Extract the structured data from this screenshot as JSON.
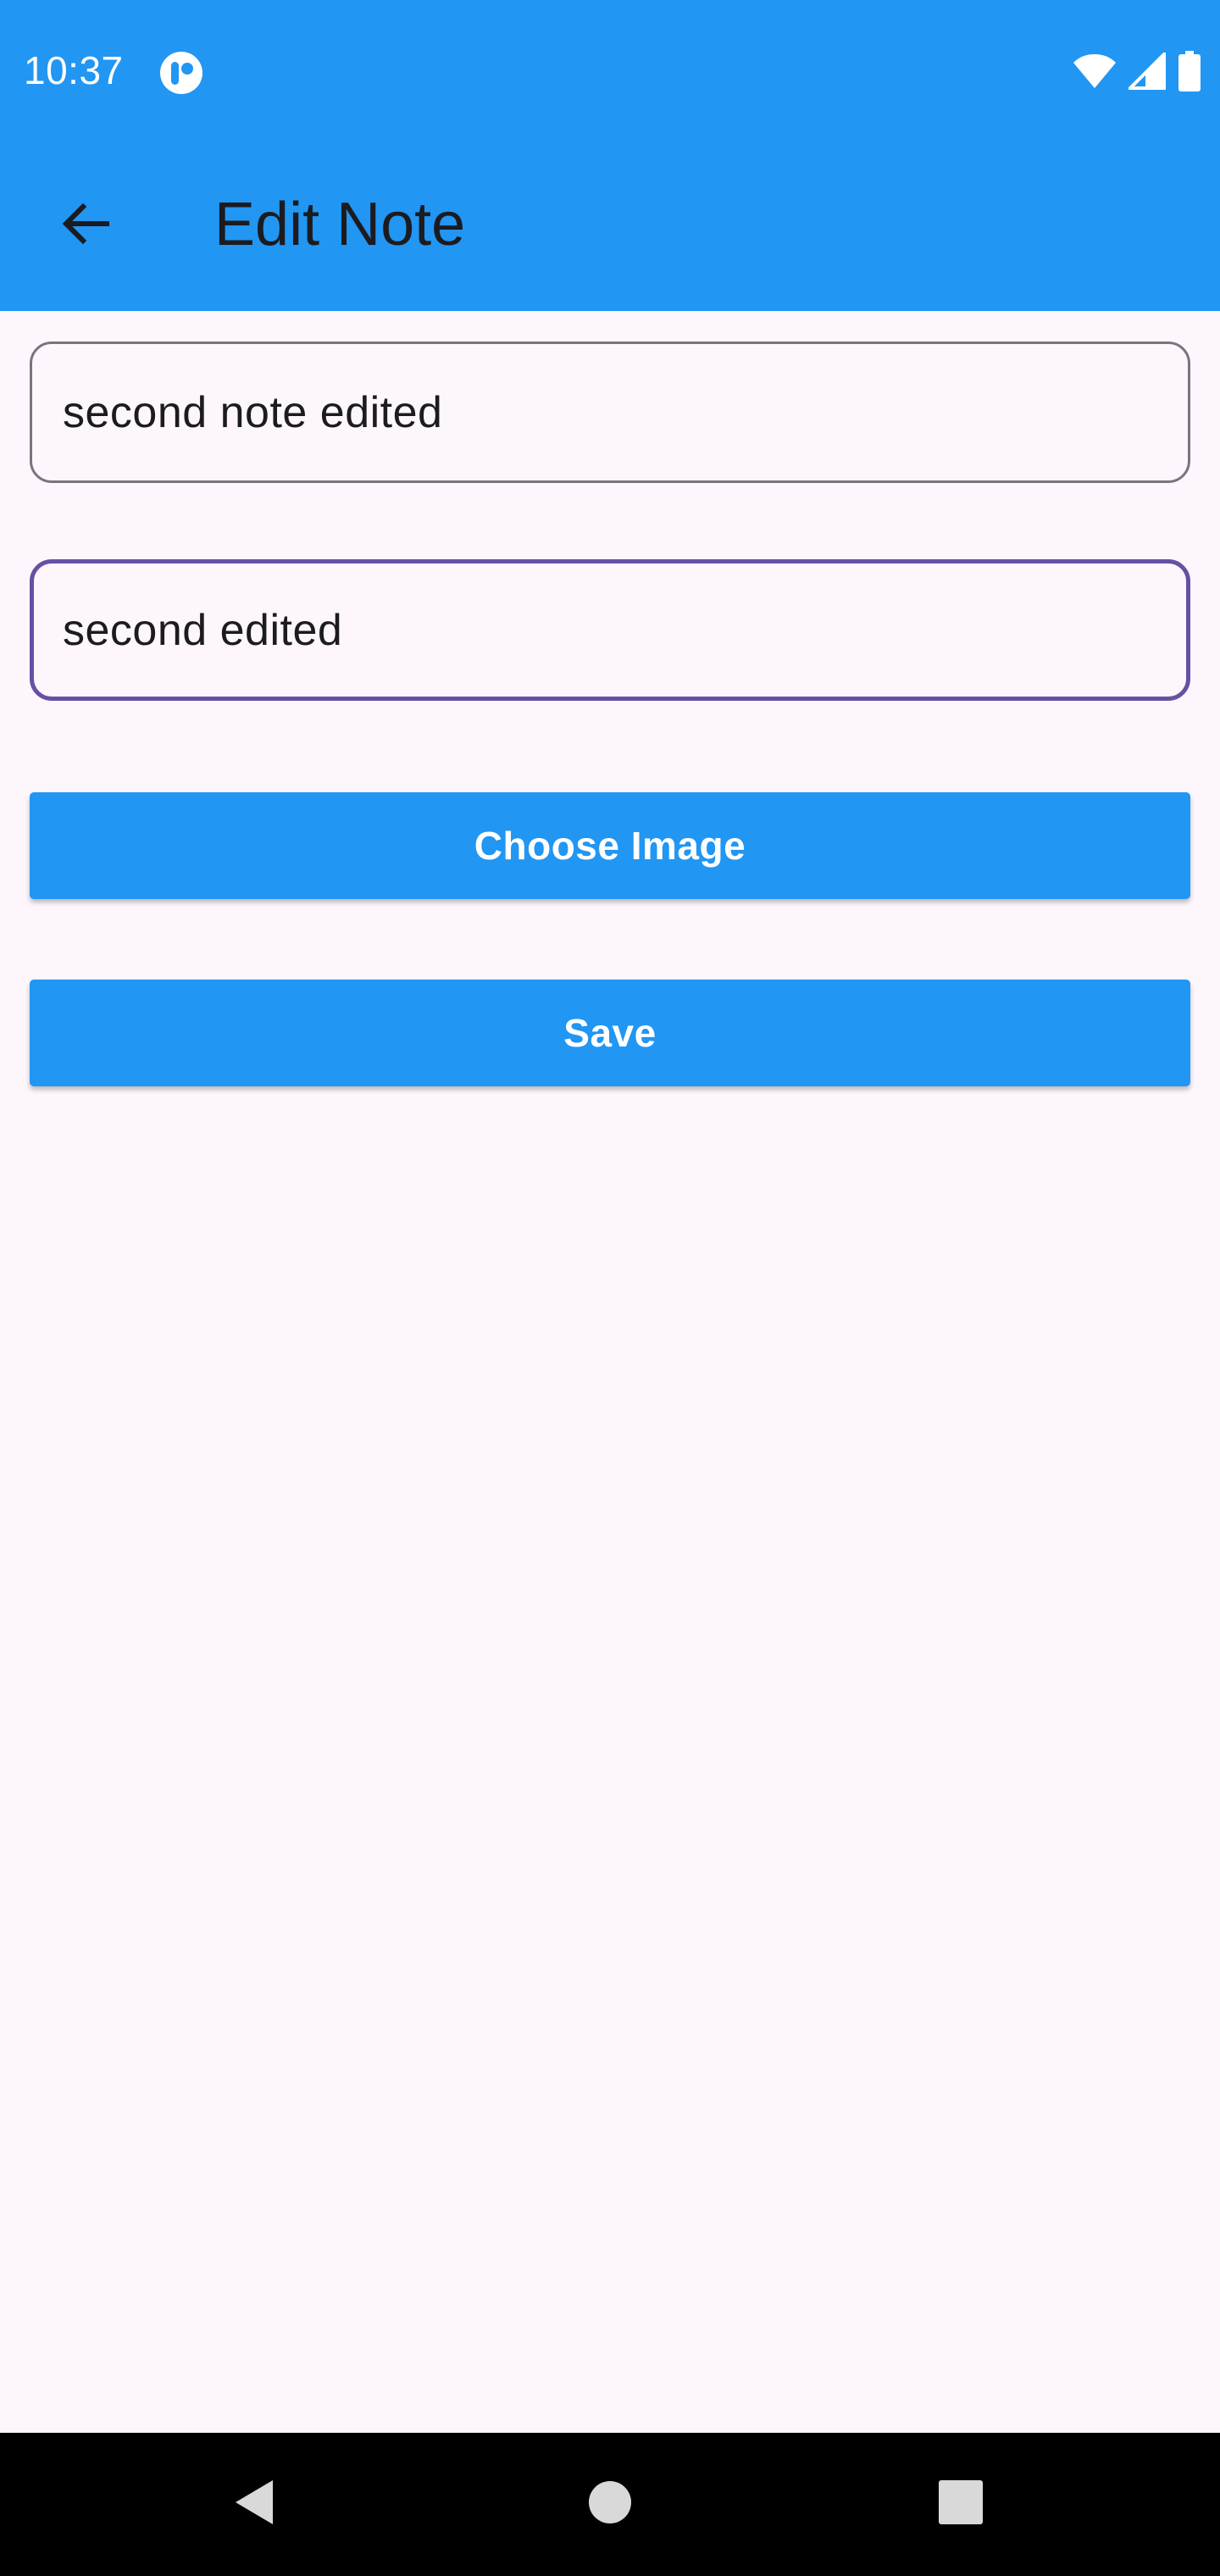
{
  "status_bar": {
    "time": "10:37",
    "app_icon": "notification-app-icon",
    "icons": [
      "wifi-icon",
      "cell-signal-icon",
      "battery-icon"
    ]
  },
  "toolbar": {
    "title": "Edit Note",
    "back_icon": "arrow-back-icon"
  },
  "form": {
    "title_value": "second note edited",
    "content_value": "second edited",
    "choose_image_label": "Choose Image",
    "save_label": "Save"
  },
  "nav_bar": {
    "icons": [
      "nav-back-icon",
      "nav-home-icon",
      "nav-recents-icon"
    ]
  },
  "colors": {
    "primary": "#2196f3",
    "background": "#fdf7fd",
    "focused_outline": "#6750a4",
    "outline": "#79747e",
    "on_surface": "#1c1b1f"
  }
}
